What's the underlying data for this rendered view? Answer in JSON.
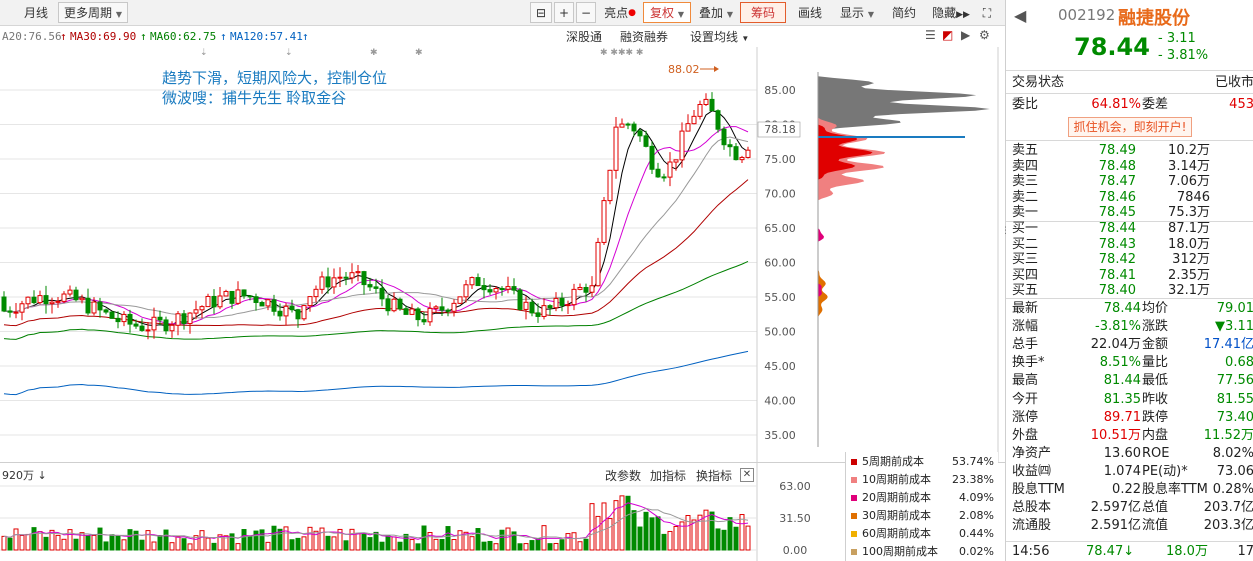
{
  "toolbar": {
    "month": "月线",
    "more_period": "更多周期",
    "bright": "亮点",
    "restore": "复权",
    "overlay": "叠加",
    "chips": "筹码",
    "draw": "画线",
    "display": "显示",
    "simple": "简约",
    "hide": "隐藏"
  },
  "ma_bar": {
    "ma20": "A20:76.56",
    "ma30": "MA30:69.90",
    "ma60": "MA60:62.75",
    "ma120": "MA120:57.41"
  },
  "chart_links": {
    "shenzhen": "深股通",
    "margin": "融资融券",
    "set_ma": "设置均线"
  },
  "annotation": {
    "line1": "趋势下滑，短期风险大，控制仓位",
    "line2": "微波嗖：捕牛先生 聆取金谷"
  },
  "peak_label": "88.02",
  "current_price_axis": "78.18",
  "price_axis": [
    "85.00",
    "80.00",
    "75.00",
    "70.00",
    "65.00",
    "60.00",
    "55.00",
    "50.00",
    "45.00",
    "40.00",
    "35.00"
  ],
  "volume": {
    "label": "920万",
    "change_param": "改参数",
    "add_indicator": "加指标",
    "swap_indicator": "换指标",
    "axis": [
      "63.00",
      "31.50",
      "0.00"
    ]
  },
  "chip_legend": [
    {
      "name": "5周期前成本",
      "pct": "53.74%",
      "color": "#cc0000"
    },
    {
      "name": "10周期前成本",
      "pct": "23.38%",
      "color": "#f08080"
    },
    {
      "name": "20周期前成本",
      "pct": "4.09%",
      "color": "#e0007a"
    },
    {
      "name": "30周期前成本",
      "pct": "2.08%",
      "color": "#e07000"
    },
    {
      "name": "60周期前成本",
      "pct": "0.44%",
      "color": "#f0b000"
    },
    {
      "name": "100周期前成本",
      "pct": "0.02%",
      "color": "#c8a060"
    }
  ],
  "stock": {
    "code": "002192",
    "name": "融捷股份",
    "price": "78.44",
    "change": "- 3.11",
    "change_pct": "- 3.81%",
    "status_label": "交易状态",
    "status_value": "已收市",
    "weibi_label": "委比",
    "weibi_value": "64.81%",
    "weicha_label": "委差",
    "weicha_value": "453",
    "promo": "抓住机会，即刻开户!"
  },
  "asks": [
    {
      "label": "卖五",
      "price": "78.49",
      "vol": "10.2万"
    },
    {
      "label": "卖四",
      "price": "78.48",
      "vol": "3.14万"
    },
    {
      "label": "卖三",
      "price": "78.47",
      "vol": "7.06万"
    },
    {
      "label": "卖二",
      "price": "78.46",
      "vol": "7846"
    },
    {
      "label": "卖一",
      "price": "78.45",
      "vol": "75.3万"
    }
  ],
  "bids": [
    {
      "label": "买一",
      "price": "78.44",
      "vol": "87.1万"
    },
    {
      "label": "买二",
      "price": "78.43",
      "vol": "18.0万"
    },
    {
      "label": "买三",
      "price": "78.42",
      "vol": "312万"
    },
    {
      "label": "买四",
      "price": "78.41",
      "vol": "2.35万"
    },
    {
      "label": "买五",
      "price": "78.40",
      "vol": "32.1万"
    }
  ],
  "stats": [
    {
      "l1": "最新",
      "v1": "78.44",
      "c1": "grn",
      "l2": "均价",
      "v2": "79.01",
      "c2": "grn"
    },
    {
      "l1": "涨幅",
      "v1": "-3.81%",
      "c1": "grn",
      "l2": "涨跌",
      "v2": "▼3.11",
      "c2": "grn"
    },
    {
      "l1": "总手",
      "v1": "22.04万",
      "c1": "",
      "l2": "金额",
      "v2": "17.41亿",
      "c2": "blu"
    },
    {
      "l1": "换手*",
      "v1": "8.51%",
      "c1": "grn",
      "l2": "量比",
      "v2": "0.68",
      "c2": "grn"
    },
    {
      "l1": "最高",
      "v1": "81.44",
      "c1": "grn",
      "l2": "最低",
      "v2": "77.56",
      "c2": "grn"
    },
    {
      "l1": "今开",
      "v1": "81.35",
      "c1": "grn",
      "l2": "昨收",
      "v2": "81.55",
      "c2": "grn"
    },
    {
      "l1": "涨停",
      "v1": "89.71",
      "c1": "red",
      "l2": "跌停",
      "v2": "73.40",
      "c2": "grn"
    },
    {
      "l1": "外盘",
      "v1": "10.51万",
      "c1": "red",
      "l2": "内盘",
      "v2": "11.52万",
      "c2": "grn"
    },
    {
      "l1": "净资产",
      "v1": "13.60",
      "c1": "",
      "l2": "ROE",
      "v2": "8.02%",
      "c2": ""
    },
    {
      "l1": "收益㈣",
      "v1": "1.074",
      "c1": "",
      "l2": "PE(动)*",
      "v2": "73.06",
      "c2": ""
    },
    {
      "l1": "股息TTM",
      "v1": "0.22",
      "c1": "",
      "l2": "股息率TTM",
      "v2": "0.28%",
      "c2": ""
    },
    {
      "l1": "总股本",
      "v1": "2.597亿",
      "c1": "",
      "l2": "总值",
      "v2": "203.7亿",
      "c2": ""
    },
    {
      "l1": "流通股",
      "v1": "2.591亿",
      "c1": "",
      "l2": "流值",
      "v2": "203.3亿",
      "c2": ""
    }
  ],
  "last_trade": {
    "time": "14:56",
    "price": "78.47",
    "vol": "18.0万",
    "extra": "17"
  },
  "colors": {
    "up": "#e00000",
    "down": "#008a00",
    "ma5": "#000000",
    "ma10": "#d400d4",
    "ma20": "#999999",
    "ma30": "#b00000",
    "ma60": "#008000",
    "ma120": "#0060c0"
  }
}
